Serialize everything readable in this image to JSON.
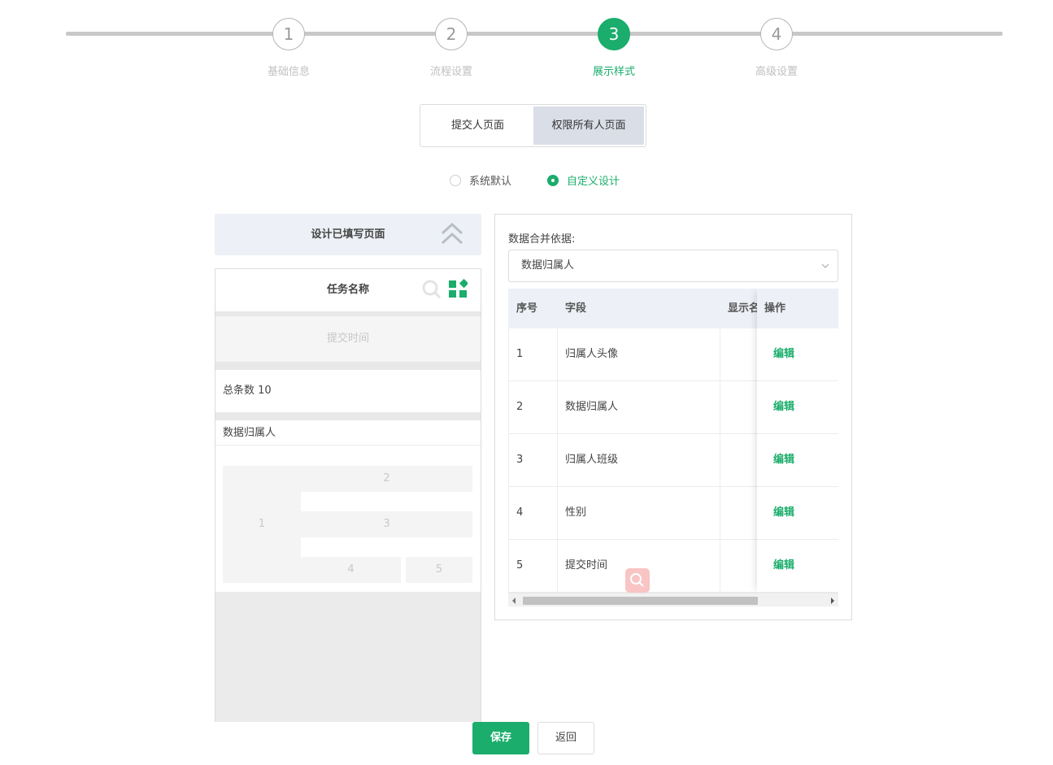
{
  "steps": [
    {
      "number": "1",
      "label": "基础信息",
      "active": false
    },
    {
      "number": "2",
      "label": "流程设置",
      "active": false
    },
    {
      "number": "3",
      "label": "展示样式",
      "active": true
    },
    {
      "number": "4",
      "label": "高级设置",
      "active": false
    }
  ],
  "page_tabs": {
    "submitter": "提交人页面",
    "owner": "权限所有人页面",
    "selected": "权限所有人页面"
  },
  "mode_radios": {
    "default_label": "系统默认",
    "custom_label": "自定义设计",
    "selected": "自定义设计"
  },
  "design_panel": {
    "header": "设计已填写页面",
    "task_name": "任务名称",
    "submit_time": "提交时间",
    "total": "总条数 10",
    "owner_title": "数据归属人",
    "cells": [
      "1",
      "2",
      "3",
      "4",
      "5"
    ]
  },
  "config_panel": {
    "merge_label": "数据合并依据:",
    "merge_value": "数据归属人",
    "columns": {
      "index": "序号",
      "field": "字段",
      "display": "显示名",
      "action": "操作"
    },
    "rows": [
      {
        "index": "1",
        "field": "归属人头像",
        "action": "编辑"
      },
      {
        "index": "2",
        "field": "数据归属人",
        "action": "编辑"
      },
      {
        "index": "3",
        "field": "归属人班级",
        "action": "编辑"
      },
      {
        "index": "4",
        "field": "性别",
        "action": "编辑"
      },
      {
        "index": "5",
        "field": "提交时间",
        "action": "编辑"
      }
    ]
  },
  "buttons": {
    "save": "保存",
    "back": "返回"
  },
  "colors": {
    "primary": "#1aad6b",
    "header_bg": "#edf0f6",
    "selected_tab_bg": "#d9dee7"
  }
}
